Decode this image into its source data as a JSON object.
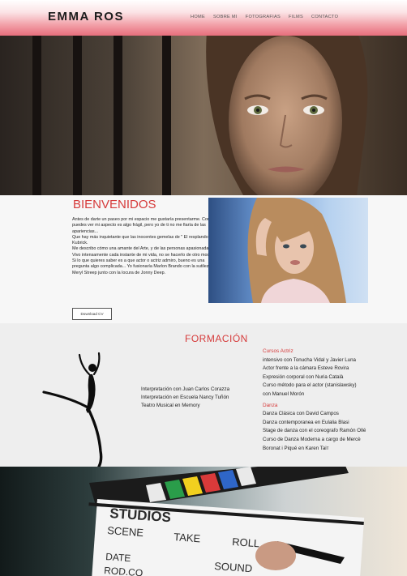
{
  "header": {
    "logo": "EMMA ROS",
    "nav": [
      "HOME",
      "SOBRE MI",
      "FOTOGRAFIAS",
      "FILMS",
      "CONTACTO"
    ]
  },
  "bio": {
    "title": "BIENVENIDOS",
    "paragraphs": [
      "Antes de darte un paseo por mi espacio me gustaría presentarme. Como puedes ver mi aspecto es algo frágil, pero yo de ti no me fiaría de las apariencias...",
      "Que hay más inquietante que las inocentes gemelas de \" El resplandor\" de Kubrick.",
      "Me describo cómo una amante del Arte, y de las personas apasionadas. Vivo intensamente cada instante de mi vida, no se hacerlo de otro modo...",
      "Si lo que quieres saber es a que actor o actriz admiro, bueno es una pregunta algo complicada... Yo fusionaría Marlon Brando con la sutileza de Meryl Streep junto con la locura de Jonny Deep."
    ],
    "cv_button": "Download CV"
  },
  "formacion": {
    "title": "FORMACIÓN",
    "middle": [
      "Interpretación con Juan Carlos Corazza",
      "Interpretación en Escuela Nancy Tuñón",
      "Teatro Musical en Memory"
    ],
    "cursos_title": "Cursos Actriz",
    "cursos": [
      "intensivo con Tonucha Vidal y Javier Luna",
      "Actor frente a la cámara Esteve Rovira",
      "Expresión corporal con Nuria Català",
      "Curso método para el actor (stanislawsky)",
      "con Manuel Morón"
    ],
    "danza_title": "Danza",
    "danza": [
      "Danza Clásica con David Campos",
      "Danza contemporanea en Eulalia Blasi",
      "Stage de danza con el coreografo Ramón Ollé",
      "Curso de Danza Moderna a cargo de Mercè",
      "Boronat i Piqué en Karen Taiт"
    ]
  },
  "clapboard": {
    "labels": [
      "STUDIOS",
      "SCENE",
      "TAKE",
      "ROLL",
      "DATE",
      "ROD.CO",
      "SOUND"
    ]
  },
  "colors": {
    "accent": "#d63a3a",
    "header_bottom": "#e76e7c"
  }
}
